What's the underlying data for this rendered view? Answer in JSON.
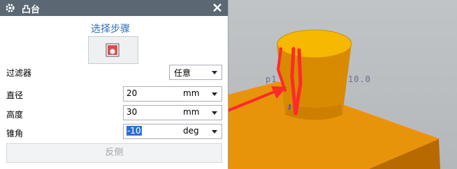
{
  "dialog": {
    "title": "凸台",
    "step_label": "选择步骤",
    "filter_label": "过滤器",
    "filter_value": "任意",
    "diameter_label": "直径",
    "diameter_value": "20",
    "diameter_unit": "mm",
    "height_label": "高度",
    "height_value": "30",
    "height_unit": "mm",
    "taper_label": "锥角",
    "taper_value": "-10",
    "taper_unit": "deg",
    "reverse_label": "反侧"
  },
  "viewport": {
    "dim_left": "p1",
    "dim_right": "10.0"
  },
  "colors": {
    "titlebar": "#5b6873",
    "boss_top": "#f6b800",
    "block": "#e08b00",
    "annotation": "#ff2a2a"
  }
}
